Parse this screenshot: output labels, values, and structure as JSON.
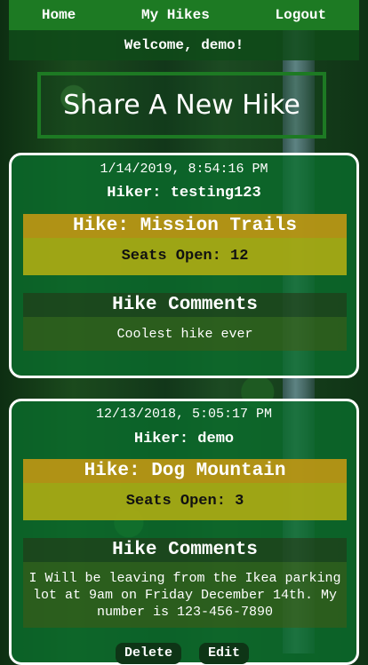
{
  "nav": {
    "home": "Home",
    "my_hikes": "My Hikes",
    "logout": "Logout"
  },
  "welcome": "Welcome, demo!",
  "share_button": "Share A New Hike",
  "posts": [
    {
      "date": "1/14/2019, 8:54:16 PM",
      "hiker": "Hiker: testing123",
      "hike": "Hike: Mission Trails",
      "seats": "Seats Open: 12",
      "comments_title": "Hike Comments",
      "comment": "Coolest hike ever"
    },
    {
      "date": "12/13/2018, 5:05:17 PM",
      "hiker": "Hiker: demo",
      "hike": "Hike: Dog Mountain",
      "seats": "Seats Open: 3",
      "comments_title": "Hike Comments",
      "comment": "I Will be leaving from the Ikea parking lot at 9am on Friday December 14th. My number is 123-456-7890",
      "delete": "Delete",
      "edit": "Edit"
    }
  ],
  "colors": {
    "nav_green": "#1d7a23",
    "hike_gold": "#be9614",
    "seats_yellow": "#aaaa14"
  }
}
